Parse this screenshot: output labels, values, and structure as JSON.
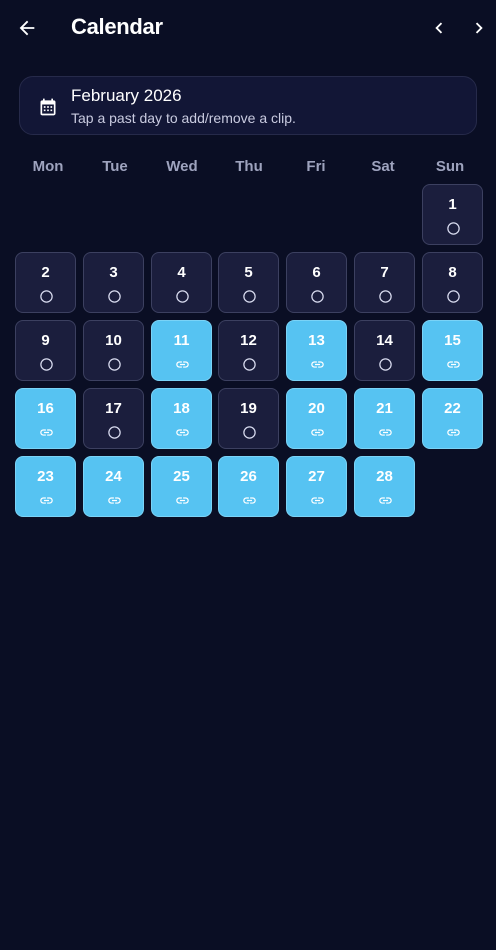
{
  "header": {
    "title": "Calendar",
    "back_icon": "arrow-left-icon",
    "prev_icon": "chevron-left-icon",
    "next_icon": "chevron-right-icon"
  },
  "info_card": {
    "icon": "calendar-icon",
    "month": "February 2026",
    "hint": "Tap a past day to add/remove a clip."
  },
  "weekdays": [
    "Mon",
    "Tue",
    "Wed",
    "Thu",
    "Fri",
    "Sat",
    "Sun"
  ],
  "colors": {
    "background": "#0a0e24",
    "card": "#121636",
    "empty_day": "#1b1e3d",
    "clip_day": "#56c3f2",
    "muted_text": "#9ea3be"
  },
  "month_start_weekday": 6,
  "days": [
    {
      "day": "1",
      "status": "empty"
    },
    {
      "day": "2",
      "status": "empty"
    },
    {
      "day": "3",
      "status": "empty"
    },
    {
      "day": "4",
      "status": "empty"
    },
    {
      "day": "5",
      "status": "empty"
    },
    {
      "day": "6",
      "status": "empty"
    },
    {
      "day": "7",
      "status": "empty"
    },
    {
      "day": "8",
      "status": "empty"
    },
    {
      "day": "9",
      "status": "empty"
    },
    {
      "day": "10",
      "status": "empty"
    },
    {
      "day": "11",
      "status": "clip"
    },
    {
      "day": "12",
      "status": "empty"
    },
    {
      "day": "13",
      "status": "clip"
    },
    {
      "day": "14",
      "status": "empty"
    },
    {
      "day": "15",
      "status": "clip"
    },
    {
      "day": "16",
      "status": "clip"
    },
    {
      "day": "17",
      "status": "empty"
    },
    {
      "day": "18",
      "status": "clip"
    },
    {
      "day": "19",
      "status": "empty"
    },
    {
      "day": "20",
      "status": "clip"
    },
    {
      "day": "21",
      "status": "clip"
    },
    {
      "day": "22",
      "status": "clip"
    },
    {
      "day": "23",
      "status": "clip"
    },
    {
      "day": "24",
      "status": "clip"
    },
    {
      "day": "25",
      "status": "clip"
    },
    {
      "day": "26",
      "status": "clip"
    },
    {
      "day": "27",
      "status": "clip"
    },
    {
      "day": "28",
      "status": "clip"
    }
  ]
}
